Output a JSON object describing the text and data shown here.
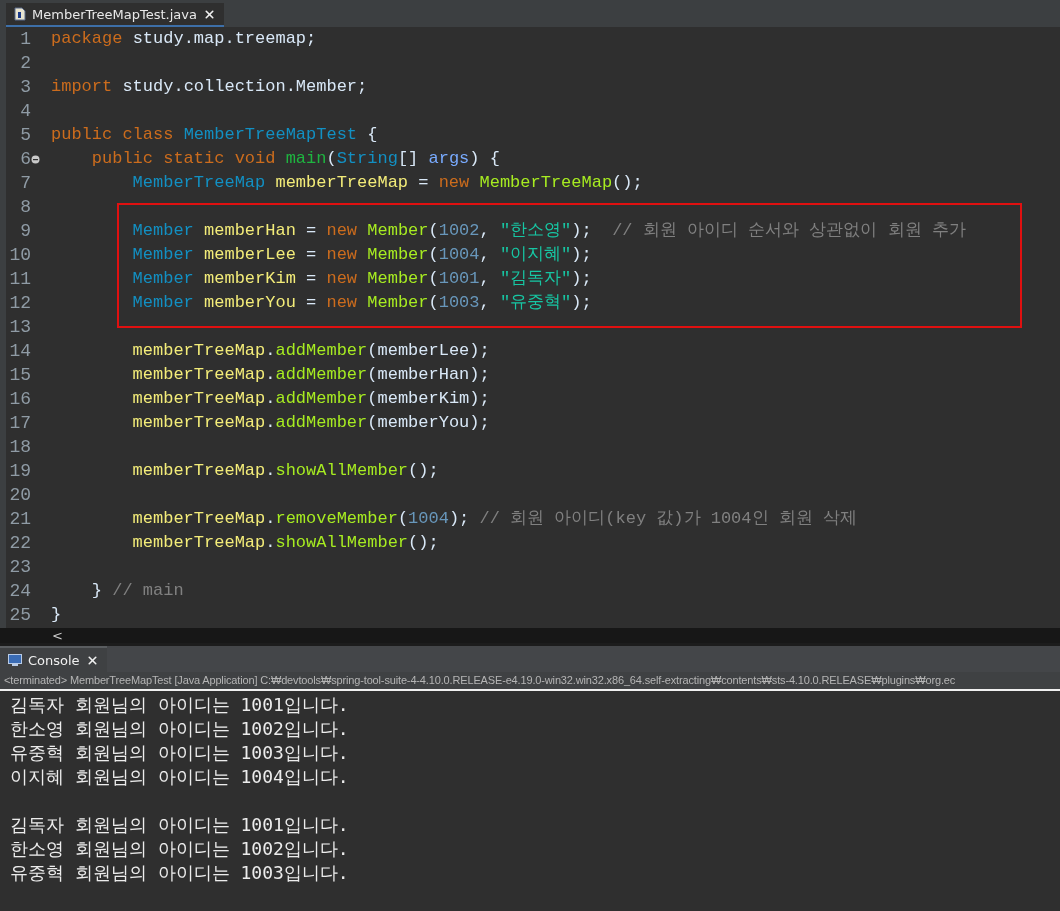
{
  "editor": {
    "tab": {
      "label": "MemberTreeMapTest.java",
      "selected": true
    },
    "lines": [
      {
        "n": "1",
        "fold": false,
        "boxed": false,
        "tokens": [
          {
            "kind": "keyword",
            "text": "package "
          },
          {
            "kind": "plain",
            "text": "study.map.treemap;"
          }
        ]
      },
      {
        "n": "2",
        "fold": false,
        "boxed": false
      },
      {
        "n": "3",
        "fold": false,
        "boxed": false,
        "tokens": [
          {
            "kind": "keyword",
            "text": "import "
          },
          {
            "kind": "plain",
            "text": "study.collection.Member;"
          }
        ]
      },
      {
        "n": "4",
        "fold": false,
        "boxed": false
      },
      {
        "n": "5",
        "fold": false,
        "boxed": false,
        "tokens": [
          {
            "kind": "keyword",
            "text": "public class "
          },
          {
            "kind": "type",
            "text": "MemberTreeMapTest"
          },
          {
            "kind": "plain",
            "text": " {"
          }
        ]
      },
      {
        "n": "6",
        "fold": true,
        "boxed": false,
        "tokens": [
          {
            "kind": "keyword",
            "text": "    public static void "
          },
          {
            "kind": "method",
            "text": "main"
          },
          {
            "kind": "plain",
            "text": "("
          },
          {
            "kind": "type",
            "text": "String"
          },
          {
            "kind": "plain",
            "text": "[] "
          },
          {
            "kind": "param",
            "text": "args"
          },
          {
            "kind": "plain",
            "text": ") {"
          }
        ]
      },
      {
        "n": "7",
        "fold": false,
        "boxed": false,
        "tokens": [
          {
            "kind": "type",
            "text": "        MemberTreeMap "
          },
          {
            "kind": "field",
            "text": "memberTreeMap"
          },
          {
            "kind": "plain",
            "text": " = "
          },
          {
            "kind": "keyword",
            "text": "new "
          },
          {
            "kind": "call",
            "text": "MemberTreeMap"
          },
          {
            "kind": "plain",
            "text": "();"
          }
        ]
      },
      {
        "n": "8",
        "fold": false,
        "boxed": false
      },
      {
        "n": "9",
        "fold": false,
        "boxed": true,
        "tokens": [
          {
            "kind": "type",
            "text": "        Member "
          },
          {
            "kind": "field",
            "text": "memberHan"
          },
          {
            "kind": "plain",
            "text": " = "
          },
          {
            "kind": "keyword",
            "text": "new "
          },
          {
            "kind": "call",
            "text": "Member"
          },
          {
            "kind": "plain",
            "text": "("
          },
          {
            "kind": "number",
            "text": "1002"
          },
          {
            "kind": "plain",
            "text": ", "
          },
          {
            "kind": "string",
            "text": "\"한소영\""
          },
          {
            "kind": "plain",
            "text": ");  "
          },
          {
            "kind": "comment",
            "text": "// 회원 아이디 순서와 상관없이 회원 추가"
          }
        ]
      },
      {
        "n": "10",
        "fold": false,
        "boxed": true,
        "tokens": [
          {
            "kind": "type",
            "text": "        Member "
          },
          {
            "kind": "field",
            "text": "memberLee"
          },
          {
            "kind": "plain",
            "text": " = "
          },
          {
            "kind": "keyword",
            "text": "new "
          },
          {
            "kind": "call",
            "text": "Member"
          },
          {
            "kind": "plain",
            "text": "("
          },
          {
            "kind": "number",
            "text": "1004"
          },
          {
            "kind": "plain",
            "text": ", "
          },
          {
            "kind": "string",
            "text": "\"이지혜\""
          },
          {
            "kind": "plain",
            "text": ");"
          }
        ]
      },
      {
        "n": "11",
        "fold": false,
        "boxed": true,
        "tokens": [
          {
            "kind": "type",
            "text": "        Member "
          },
          {
            "kind": "field",
            "text": "memberKim"
          },
          {
            "kind": "plain",
            "text": " = "
          },
          {
            "kind": "keyword",
            "text": "new "
          },
          {
            "kind": "call",
            "text": "Member"
          },
          {
            "kind": "plain",
            "text": "("
          },
          {
            "kind": "number",
            "text": "1001"
          },
          {
            "kind": "plain",
            "text": ", "
          },
          {
            "kind": "string",
            "text": "\"김독자\""
          },
          {
            "kind": "plain",
            "text": ");"
          }
        ]
      },
      {
        "n": "12",
        "fold": false,
        "boxed": true,
        "tokens": [
          {
            "kind": "type",
            "text": "        Member "
          },
          {
            "kind": "field",
            "text": "memberYou"
          },
          {
            "kind": "plain",
            "text": " = "
          },
          {
            "kind": "keyword",
            "text": "new "
          },
          {
            "kind": "call",
            "text": "Member"
          },
          {
            "kind": "plain",
            "text": "("
          },
          {
            "kind": "number",
            "text": "1003"
          },
          {
            "kind": "plain",
            "text": ", "
          },
          {
            "kind": "string",
            "text": "\"유중혁\""
          },
          {
            "kind": "plain",
            "text": ");"
          }
        ]
      },
      {
        "n": "13",
        "fold": false,
        "boxed": false
      },
      {
        "n": "14",
        "fold": false,
        "boxed": false,
        "tokens": [
          {
            "kind": "field",
            "text": "        memberTreeMap"
          },
          {
            "kind": "plain",
            "text": "."
          },
          {
            "kind": "call",
            "text": "addMember"
          },
          {
            "kind": "plain",
            "text": "(memberLee);"
          }
        ]
      },
      {
        "n": "15",
        "fold": false,
        "boxed": false,
        "tokens": [
          {
            "kind": "field",
            "text": "        memberTreeMap"
          },
          {
            "kind": "plain",
            "text": "."
          },
          {
            "kind": "call",
            "text": "addMember"
          },
          {
            "kind": "plain",
            "text": "(memberHan);"
          }
        ]
      },
      {
        "n": "16",
        "fold": false,
        "boxed": false,
        "tokens": [
          {
            "kind": "field",
            "text": "        memberTreeMap"
          },
          {
            "kind": "plain",
            "text": "."
          },
          {
            "kind": "call",
            "text": "addMember"
          },
          {
            "kind": "plain",
            "text": "(memberKim);"
          }
        ]
      },
      {
        "n": "17",
        "fold": false,
        "boxed": false,
        "tokens": [
          {
            "kind": "field",
            "text": "        memberTreeMap"
          },
          {
            "kind": "plain",
            "text": "."
          },
          {
            "kind": "call",
            "text": "addMember"
          },
          {
            "kind": "plain",
            "text": "(memberYou);"
          }
        ]
      },
      {
        "n": "18",
        "fold": false,
        "boxed": false
      },
      {
        "n": "19",
        "fold": false,
        "boxed": false,
        "tokens": [
          {
            "kind": "field",
            "text": "        memberTreeMap"
          },
          {
            "kind": "plain",
            "text": "."
          },
          {
            "kind": "call",
            "text": "showAllMember"
          },
          {
            "kind": "plain",
            "text": "();"
          }
        ]
      },
      {
        "n": "20",
        "fold": false,
        "boxed": false
      },
      {
        "n": "21",
        "fold": false,
        "boxed": false,
        "tokens": [
          {
            "kind": "field",
            "text": "        memberTreeMap"
          },
          {
            "kind": "plain",
            "text": "."
          },
          {
            "kind": "call",
            "text": "removeMember"
          },
          {
            "kind": "plain",
            "text": "("
          },
          {
            "kind": "number",
            "text": "1004"
          },
          {
            "kind": "plain",
            "text": "); "
          },
          {
            "kind": "comment",
            "text": "// 회원 아이디(key 값)가 1004인 회원 삭제"
          }
        ]
      },
      {
        "n": "22",
        "fold": false,
        "boxed": false,
        "tokens": [
          {
            "kind": "field",
            "text": "        memberTreeMap"
          },
          {
            "kind": "plain",
            "text": "."
          },
          {
            "kind": "call",
            "text": "showAllMember"
          },
          {
            "kind": "plain",
            "text": "();"
          }
        ]
      },
      {
        "n": "23",
        "fold": false,
        "boxed": false
      },
      {
        "n": "24",
        "fold": false,
        "boxed": false,
        "tokens": [
          {
            "kind": "plain",
            "text": "    } "
          },
          {
            "kind": "comment",
            "text": "// main"
          }
        ]
      },
      {
        "n": "25",
        "fold": false,
        "boxed": false,
        "tokens": [
          {
            "kind": "plain",
            "text": "}"
          }
        ]
      }
    ],
    "scroll_left": "<"
  },
  "console": {
    "tab": {
      "label": "Console",
      "selected": true
    },
    "status": "<terminated> MemberTreeMapTest [Java Application] C:₩devtools₩spring-tool-suite-4-4.10.0.RELEASE-e4.19.0-win32.win32.x86_64.self-extracting₩contents₩sts-4.10.0.RELEASE₩plugins₩org.ec",
    "output_groups": [
      [
        "김독자 회원님의 아이디는 1001입니다.",
        "한소영 회원님의 아이디는 1002입니다.",
        "유중혁 회원님의 아이디는 1003입니다.",
        "이지혜 회원님의 아이디는 1004입니다."
      ],
      [
        "김독자 회원님의 아이디는 1001입니다.",
        "한소영 회원님의 아이디는 1002입니다.",
        "유중혁 회원님의 아이디는 1003입니다."
      ]
    ]
  }
}
